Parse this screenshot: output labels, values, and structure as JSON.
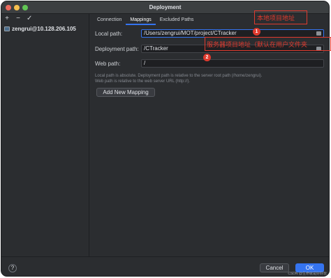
{
  "window": {
    "title": "Deployment"
  },
  "sidebar": {
    "toolbar": {
      "add": "+",
      "remove": "−",
      "apply": "✓"
    },
    "server": "zengrui@10.128.206.105"
  },
  "tabs": [
    {
      "label": "Connection"
    },
    {
      "label": "Mappings",
      "active": true
    },
    {
      "label": "Excluded Paths"
    }
  ],
  "mappings": {
    "local_label": "Local path:",
    "local_value": "/Users/zengrui/MOT/project/CTracker",
    "deploy_label": "Deployment path:",
    "deploy_value": "/CTracker",
    "web_label": "Web path:",
    "web_value": "/",
    "note_line1": "Local path is absolute. Deployment path is relative to the server root path (/home/zengrui).",
    "note_line2": "Web path is relative to the web server URL (http://).",
    "add_mapping": "Add New Mapping"
  },
  "footer": {
    "help": "?",
    "cancel": "Cancel",
    "ok": "OK"
  },
  "annotations": {
    "local_note": "本地项目地址",
    "server_note": "服务器项目地址（默认在用户文件夹",
    "badge1": "1",
    "badge2": "2",
    "color": "#e03a2e"
  },
  "watermark": "CSDN @生命就是好好玩"
}
